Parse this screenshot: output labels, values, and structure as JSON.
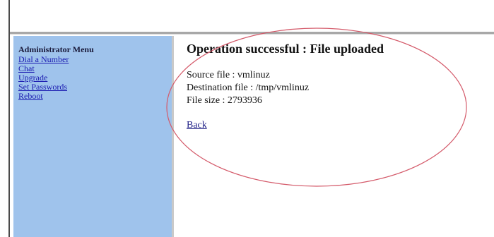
{
  "sidebar": {
    "title": "Administrator Menu",
    "items": [
      {
        "label": "Dial a Number"
      },
      {
        "label": "Chat"
      },
      {
        "label": "Upgrade"
      },
      {
        "label": "Set Passwords"
      },
      {
        "label": "Reboot"
      }
    ]
  },
  "main": {
    "title": "Operation successful : File uploaded",
    "source_file": "Source file : vmlinuz",
    "destination_file": "Destination file : /tmp/vmlinuz",
    "file_size": "File size : 2793936",
    "back_label": "Back"
  },
  "colors": {
    "sidebar_bg": "#9fc3ec",
    "link": "#1a1ab0",
    "annotation": "#d45a6a"
  }
}
